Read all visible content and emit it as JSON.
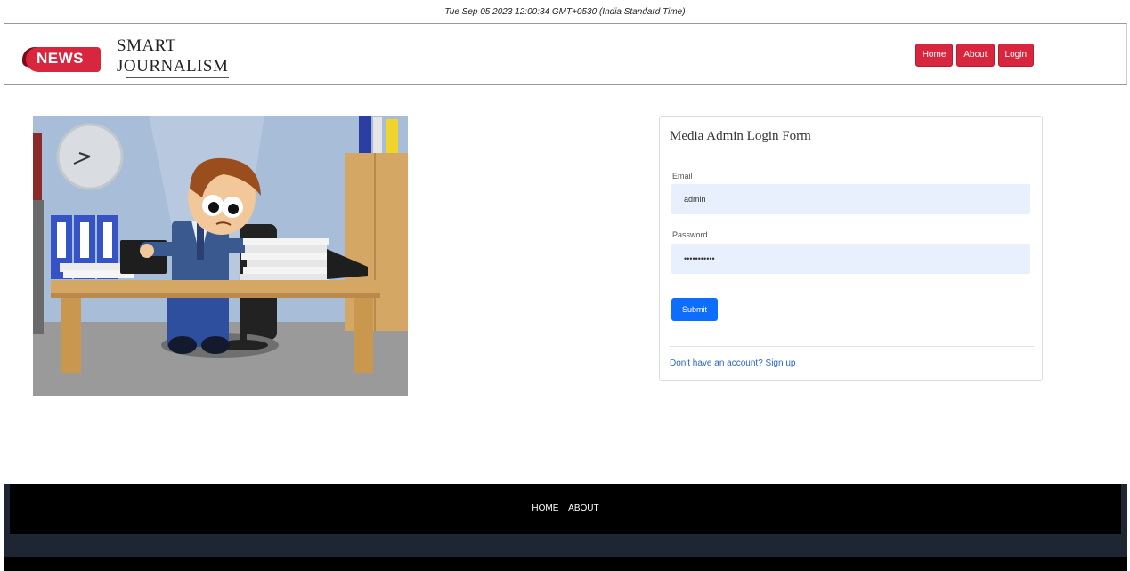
{
  "datetime": "Tue Sep 05 2023 12:00:34 GMT+0530 (India Standard Time)",
  "brand": {
    "badge": "NEWS",
    "line1": "SMART",
    "line2": "JOURNALISM"
  },
  "nav": {
    "home": "Home",
    "about": "About",
    "login": "Login"
  },
  "login": {
    "title": "Media Admin Login Form",
    "email_label": "Email",
    "email_value": "admin",
    "password_label": "Password",
    "password_value": "•••••••••••",
    "submit": "Submit",
    "signup": "Don't have an account? Sign up"
  },
  "footer": {
    "home": "HOME",
    "about": "ABOUT"
  },
  "colors": {
    "accent": "#d7263d",
    "primary": "#0d6efd",
    "footer": "#000000"
  }
}
